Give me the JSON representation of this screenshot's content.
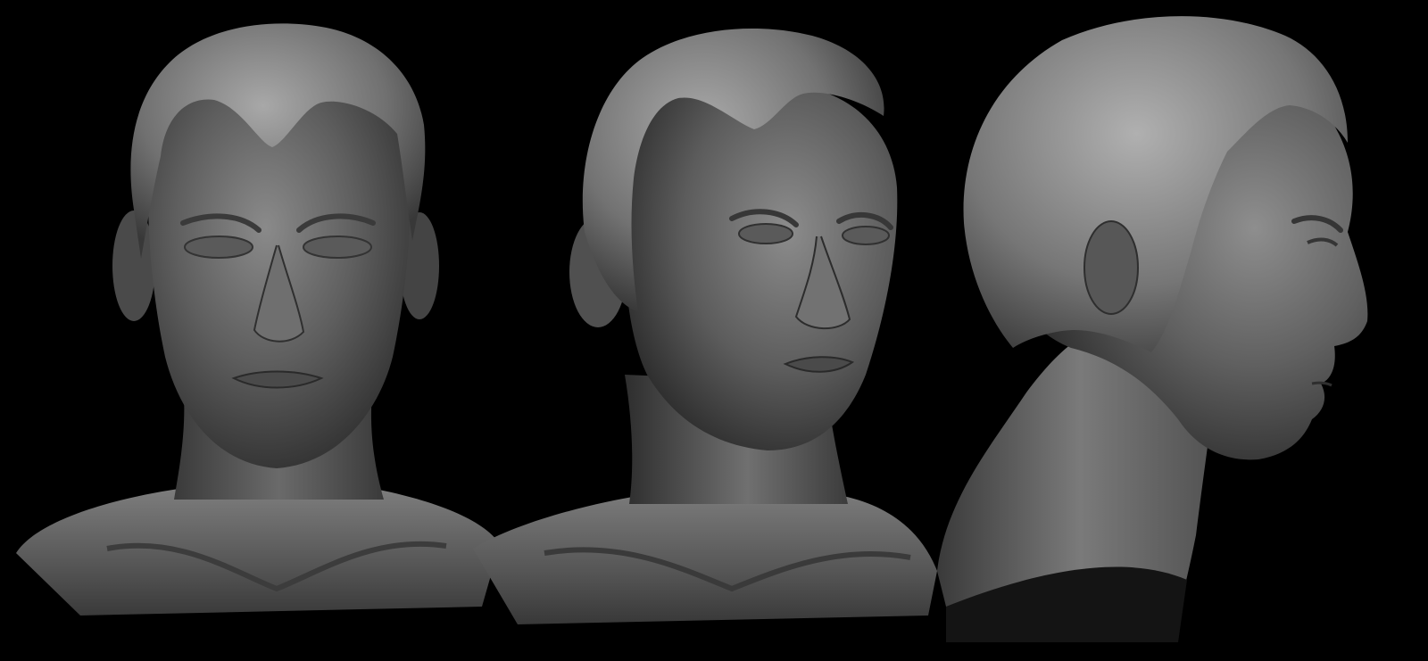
{
  "scene": {
    "background_color": "#000000",
    "clay_color": "#6e6e6e",
    "clay_highlight": "#a4a4a4",
    "clay_shadow": "#262626",
    "hair_color": "#7a7a7a",
    "hair_highlight": "#b0b0b0"
  },
  "views": [
    {
      "name": "front-view"
    },
    {
      "name": "three-quarter-view"
    },
    {
      "name": "profile-view"
    }
  ]
}
